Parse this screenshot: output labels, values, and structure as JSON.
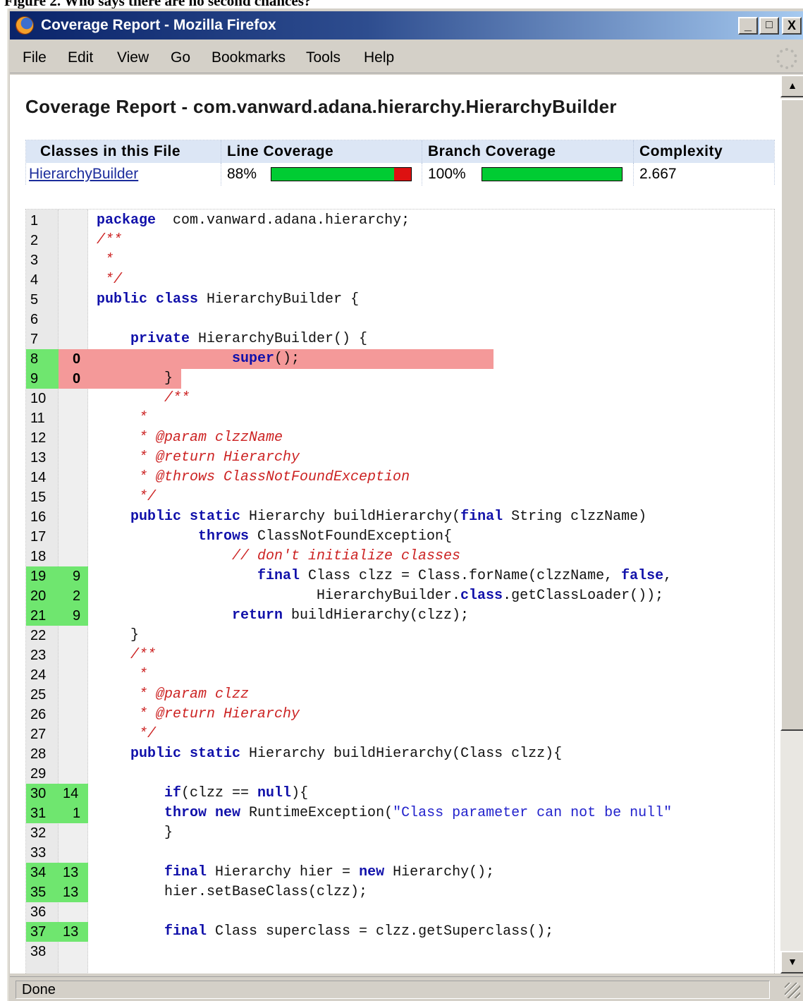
{
  "figure_caption": "Figure 2. Who says there are no second chances?",
  "window": {
    "title": "Coverage Report - Mozilla Firefox",
    "controls": {
      "minimize": "_",
      "maximize": "□",
      "close": "X"
    }
  },
  "menu": [
    "File",
    "Edit",
    "View",
    "Go",
    "Bookmarks",
    "Tools",
    "Help"
  ],
  "page": {
    "title": "Coverage Report - com.vanward.adana.hierarchy.HierarchyBuilder"
  },
  "coverage_table": {
    "headers": [
      "Classes in this File",
      "Line Coverage",
      "Branch Coverage",
      "Complexity"
    ],
    "row": {
      "class_name": "HierarchyBuilder",
      "line_coverage_text": "88%",
      "line_coverage": 0.88,
      "branch_coverage_text": "100%",
      "branch_coverage": 1.0,
      "complexity": "2.667"
    },
    "colors": {
      "covered": "#00cc33",
      "uncovered": "#dd1111"
    }
  },
  "source": {
    "colors": {
      "hit": "#6fe66f",
      "miss": "#f49999",
      "keyword": "#1111aa",
      "comment": "#cc2222"
    },
    "lines": [
      {
        "n": "1",
        "hits": "",
        "tokens": [
          [
            "kw",
            "package"
          ],
          [
            "",
            "  com.vanward.adana.hierarchy;"
          ]
        ],
        "indent": 0
      },
      {
        "n": "2",
        "hits": "",
        "tokens": [
          [
            "cm",
            "/**"
          ]
        ],
        "indent": 0
      },
      {
        "n": "3",
        "hits": "",
        "tokens": [
          [
            "cm",
            " *"
          ]
        ],
        "indent": 0
      },
      {
        "n": "4",
        "hits": "",
        "tokens": [
          [
            "cm",
            " */"
          ]
        ],
        "indent": 0
      },
      {
        "n": "5",
        "hits": "",
        "tokens": [
          [
            "kw",
            "public class"
          ],
          [
            "",
            " HierarchyBuilder {"
          ]
        ],
        "indent": 0
      },
      {
        "n": "6",
        "hits": "",
        "tokens": [],
        "indent": 0
      },
      {
        "n": "7",
        "hits": "",
        "tokens": [
          [
            "kw",
            "private"
          ],
          [
            "",
            " HierarchyBuilder() {"
          ]
        ],
        "indent": 4
      },
      {
        "n": "8",
        "hits": "0",
        "tokens": [
          [
            "kw",
            "super"
          ],
          [
            "",
            "();"
          ]
        ],
        "indent": 16,
        "miss": true
      },
      {
        "n": "9",
        "hits": "0",
        "tokens": [
          [
            "",
            "}"
          ]
        ],
        "indent": 8,
        "miss": true
      },
      {
        "n": "10",
        "hits": "",
        "tokens": [
          [
            "cm",
            "/**"
          ]
        ],
        "indent": 8
      },
      {
        "n": "11",
        "hits": "",
        "tokens": [
          [
            "cm",
            " *"
          ]
        ],
        "indent": 4
      },
      {
        "n": "12",
        "hits": "",
        "tokens": [
          [
            "cm",
            " * @param clzzName"
          ]
        ],
        "indent": 4
      },
      {
        "n": "13",
        "hits": "",
        "tokens": [
          [
            "cm",
            " * @return Hierarchy"
          ]
        ],
        "indent": 4
      },
      {
        "n": "14",
        "hits": "",
        "tokens": [
          [
            "cm",
            " * @throws ClassNotFoundException"
          ]
        ],
        "indent": 4
      },
      {
        "n": "15",
        "hits": "",
        "tokens": [
          [
            "cm",
            " */"
          ]
        ],
        "indent": 4
      },
      {
        "n": "16",
        "hits": "",
        "tokens": [
          [
            "kw",
            "public static"
          ],
          [
            "",
            " Hierarchy buildHierarchy("
          ],
          [
            "kw",
            "final"
          ],
          [
            "",
            " String clzzName)"
          ]
        ],
        "indent": 4
      },
      {
        "n": "17",
        "hits": "",
        "tokens": [
          [
            "kw",
            "throws"
          ],
          [
            "",
            " ClassNotFoundException{"
          ]
        ],
        "indent": 12
      },
      {
        "n": "18",
        "hits": "",
        "tokens": [
          [
            "cm",
            "// don't initialize classes"
          ]
        ],
        "indent": 16
      },
      {
        "n": "19",
        "hits": "9",
        "tokens": [
          [
            "kw",
            "final"
          ],
          [
            "",
            " Class clzz = Class.forName(clzzName, "
          ],
          [
            "kw",
            "false"
          ],
          [
            "",
            ","
          ]
        ],
        "indent": 19
      },
      {
        "n": "20",
        "hits": "2",
        "tokens": [
          [
            "",
            "HierarchyBuilder."
          ],
          [
            "kw",
            "class"
          ],
          [
            "",
            ".getClassLoader());"
          ]
        ],
        "indent": 26
      },
      {
        "n": "21",
        "hits": "9",
        "tokens": [
          [
            "kw",
            "return"
          ],
          [
            "",
            " buildHierarchy(clzz);"
          ]
        ],
        "indent": 16
      },
      {
        "n": "22",
        "hits": "",
        "tokens": [
          [
            "",
            "}"
          ]
        ],
        "indent": 4
      },
      {
        "n": "23",
        "hits": "",
        "tokens": [
          [
            "cm",
            "/**"
          ]
        ],
        "indent": 4
      },
      {
        "n": "24",
        "hits": "",
        "tokens": [
          [
            "cm",
            " *"
          ]
        ],
        "indent": 4
      },
      {
        "n": "25",
        "hits": "",
        "tokens": [
          [
            "cm",
            " * @param clzz"
          ]
        ],
        "indent": 4
      },
      {
        "n": "26",
        "hits": "",
        "tokens": [
          [
            "cm",
            " * @return Hierarchy"
          ]
        ],
        "indent": 4
      },
      {
        "n": "27",
        "hits": "",
        "tokens": [
          [
            "cm",
            " */"
          ]
        ],
        "indent": 4
      },
      {
        "n": "28",
        "hits": "",
        "tokens": [
          [
            "kw",
            "public static"
          ],
          [
            "",
            " Hierarchy buildHierarchy(Class clzz){"
          ]
        ],
        "indent": 4
      },
      {
        "n": "29",
        "hits": "",
        "tokens": [],
        "indent": 0
      },
      {
        "n": "30",
        "hits": "14",
        "tokens": [
          [
            "kw",
            "if"
          ],
          [
            "",
            "(clzz == "
          ],
          [
            "kw",
            "null"
          ],
          [
            "",
            "){"
          ]
        ],
        "indent": 8
      },
      {
        "n": "31",
        "hits": "1",
        "tokens": [
          [
            "kw",
            "throw new"
          ],
          [
            "",
            " RuntimeException("
          ],
          [
            "st",
            "\"Class parameter can not be null\""
          ]
        ],
        "indent": 8
      },
      {
        "n": "32",
        "hits": "",
        "tokens": [
          [
            "",
            "}"
          ]
        ],
        "indent": 8
      },
      {
        "n": "33",
        "hits": "",
        "tokens": [],
        "indent": 0
      },
      {
        "n": "34",
        "hits": "13",
        "tokens": [
          [
            "kw",
            "final"
          ],
          [
            "",
            " Hierarchy hier = "
          ],
          [
            "kw",
            "new"
          ],
          [
            "",
            " Hierarchy();"
          ]
        ],
        "indent": 8
      },
      {
        "n": "35",
        "hits": "13",
        "tokens": [
          [
            "",
            "hier.setBaseClass(clzz);"
          ]
        ],
        "indent": 8
      },
      {
        "n": "36",
        "hits": "",
        "tokens": [],
        "indent": 0
      },
      {
        "n": "37",
        "hits": "13",
        "tokens": [
          [
            "kw",
            "final"
          ],
          [
            "",
            " Class superclass = clzz.getSuperclass();"
          ]
        ],
        "indent": 8
      },
      {
        "n": "38",
        "hits": "",
        "tokens": [],
        "indent": 0
      }
    ]
  },
  "status": {
    "text": "Done"
  }
}
